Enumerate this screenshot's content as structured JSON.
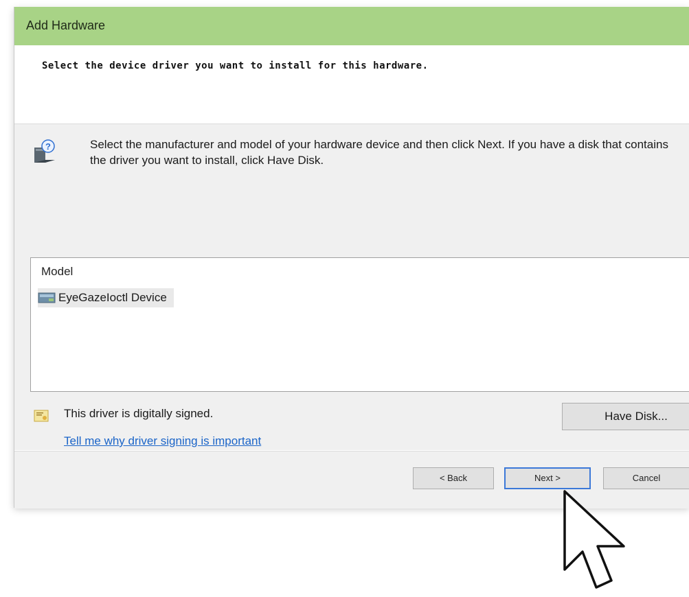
{
  "window": {
    "title": "Add Hardware"
  },
  "header": {
    "heading": "Select the device driver you want to install for this hardware."
  },
  "instruction": "Select the manufacturer and model of your hardware device and then click Next. If you have a disk that contains the driver you want to install, click Have Disk.",
  "model_list": {
    "column_header": "Model",
    "items": [
      {
        "label": "EyeGazeIoctl Device",
        "icon": "device-icon"
      }
    ]
  },
  "signing": {
    "status_text": "This driver is digitally signed.",
    "link_text": "Tell me why driver signing is important",
    "icon": "certificate-icon"
  },
  "buttons": {
    "have_disk": "Have Disk...",
    "back": "< Back",
    "next": "Next >",
    "cancel": "Cancel"
  },
  "colors": {
    "titlebar": "#a8d386",
    "link": "#1a64c8",
    "default_button_border": "#3b78d8"
  }
}
